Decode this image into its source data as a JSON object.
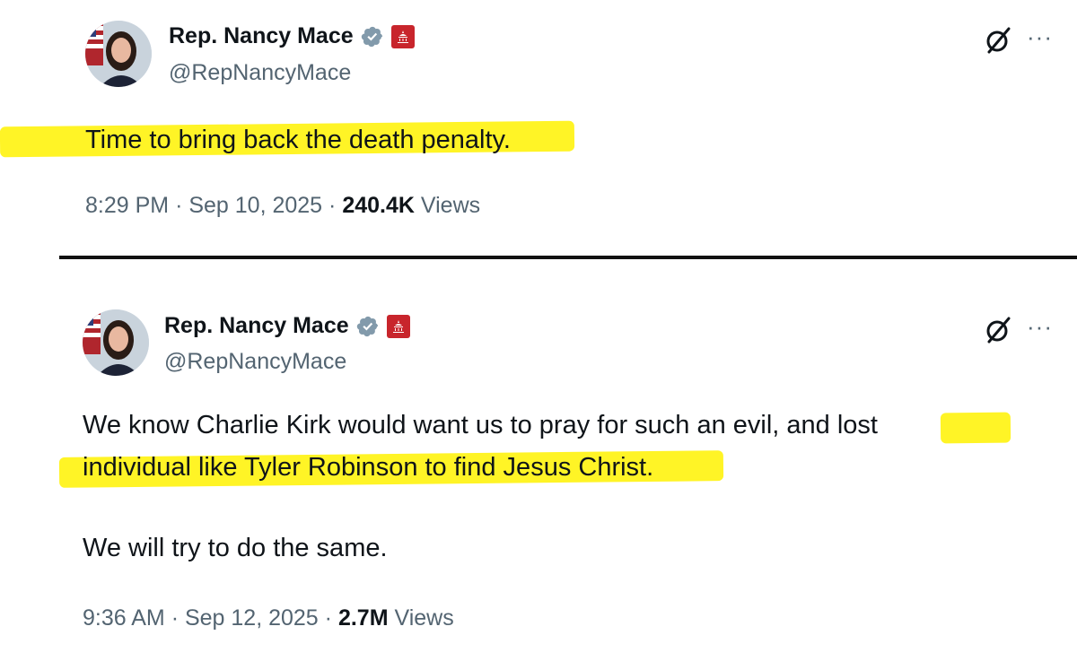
{
  "tweets": [
    {
      "display_name": "Rep. Nancy Mace",
      "handle": "@RepNancyMace",
      "text": "Time to bring back the death penalty.",
      "time": "8:29 PM",
      "date": "Sep 10, 2025",
      "separator": "·",
      "views_count": "240.4K",
      "views_label": "Views",
      "more_label": "···"
    },
    {
      "display_name": "Rep. Nancy Mace",
      "handle": "@RepNancyMace",
      "text_lines": [
        "We know Charlie Kirk would want us to pray for such an evil, and lost",
        "individual like Tyler Robinson to find Jesus Christ.",
        "We will try to do the same."
      ],
      "time": "9:36 AM",
      "date": "Sep 12, 2025",
      "separator": "·",
      "views_count": "2.7M",
      "views_label": "Views",
      "more_label": "···"
    }
  ],
  "colors": {
    "highlight": "#fff200",
    "verified_badge": "#829aab",
    "affiliation_badge": "#c8252c",
    "secondary_text": "#536471",
    "primary_text": "#0f1419"
  },
  "icons": [
    "verified-badge-icon",
    "government-affiliation-icon",
    "grok-icon",
    "more-options-icon"
  ]
}
